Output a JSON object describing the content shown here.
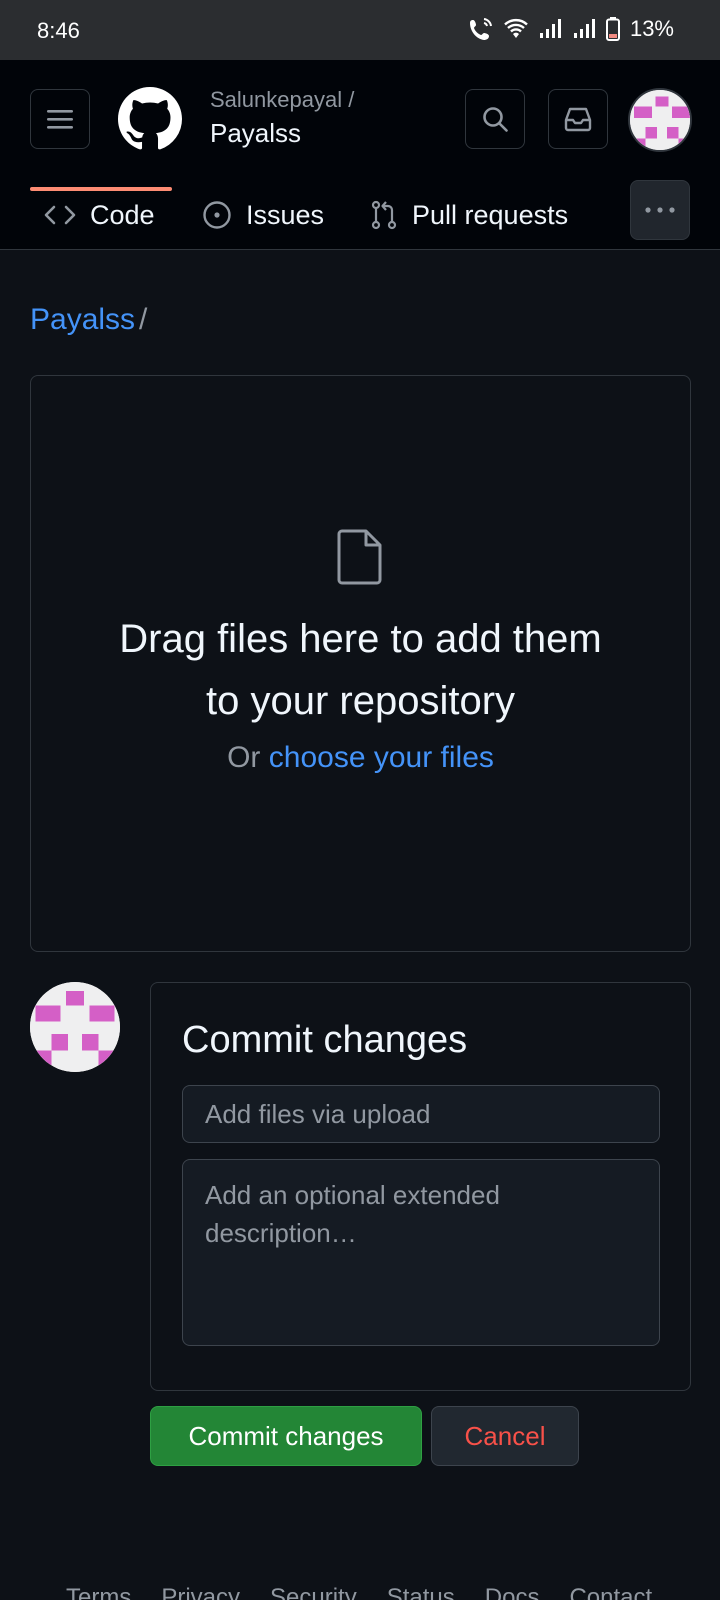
{
  "status_bar": {
    "time": "8:46",
    "battery": "13%",
    "icons": [
      "wifi-calling-icon",
      "wifi-icon",
      "signal-icon",
      "signal-icon",
      "battery-low-icon"
    ]
  },
  "header": {
    "owner": "Salunkepayal /",
    "repo": "Payalss",
    "tabs": [
      {
        "label": "Code",
        "icon": "code-icon",
        "selected": true
      },
      {
        "label": "Issues",
        "icon": "issue-opened-icon"
      },
      {
        "label": "Pull requests",
        "icon": "git-pull-request-icon"
      }
    ],
    "accent_color": "#fd8c73"
  },
  "breadcrumb": {
    "repo_link": "Payalss",
    "separator": "/"
  },
  "dropzone": {
    "title": "Drag files here to add them to your repository",
    "or_text": "Or ",
    "choose_link": "choose your files"
  },
  "commit": {
    "title": "Commit changes",
    "message_placeholder": "Add files via upload",
    "description_placeholder": "Add an optional extended description…",
    "commit_button": "Commit changes",
    "cancel_button": "Cancel",
    "commit_color": "#238636",
    "cancel_color": "#f85149"
  },
  "footer": {
    "links": [
      "Terms",
      "Privacy",
      "Security",
      "Status",
      "Docs",
      "Contact"
    ]
  }
}
